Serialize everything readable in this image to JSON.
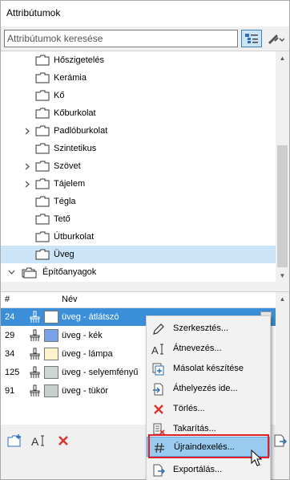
{
  "window": {
    "title": "Attribútumok"
  },
  "search": {
    "placeholder": "Attribútumok keresése"
  },
  "tree": {
    "items": [
      {
        "label": "Hőszigetelés",
        "has_children": false,
        "selected": false
      },
      {
        "label": "Kerámia",
        "has_children": false,
        "selected": false
      },
      {
        "label": "Kő",
        "has_children": false,
        "selected": false
      },
      {
        "label": "Kőburkolat",
        "has_children": false,
        "selected": false
      },
      {
        "label": "Padlóburkolat",
        "has_children": true,
        "selected": false
      },
      {
        "label": "Szintetikus",
        "has_children": false,
        "selected": false
      },
      {
        "label": "Szövet",
        "has_children": true,
        "selected": false
      },
      {
        "label": "Tájelem",
        "has_children": true,
        "selected": false
      },
      {
        "label": "Tégla",
        "has_children": false,
        "selected": false
      },
      {
        "label": "Tető",
        "has_children": false,
        "selected": false
      },
      {
        "label": "Útburkolat",
        "has_children": false,
        "selected": false
      },
      {
        "label": "Üveg",
        "has_children": false,
        "selected": true
      }
    ],
    "group": {
      "label": "Építőanyagok"
    }
  },
  "table": {
    "columns": {
      "num": "#",
      "name": "Név"
    },
    "rows": [
      {
        "num": "24",
        "name": "üveg - átlátszó",
        "swatch": "#ffffff",
        "selected": true
      },
      {
        "num": "29",
        "name": "üveg - kék",
        "swatch": "#7aa0e8",
        "selected": false
      },
      {
        "num": "34",
        "name": "üveg - lámpa",
        "swatch": "#fcf3cc",
        "selected": false
      },
      {
        "num": "125",
        "name": "üveg - selyemfényű",
        "swatch": "#cfd4d4",
        "selected": false
      },
      {
        "num": "91",
        "name": "üveg - tükör",
        "swatch": "#c9cfcf",
        "selected": false
      }
    ]
  },
  "context_menu": {
    "items": [
      {
        "label": "Szerkesztés...",
        "icon": "pencil-icon"
      },
      {
        "label": "Átnevezés...",
        "icon": "rename-icon"
      },
      {
        "label": "Másolat készítése",
        "icon": "duplicate-icon"
      },
      {
        "label": "Áthelyezés ide...",
        "icon": "move-to-icon"
      },
      {
        "label": "Törlés...",
        "icon": "delete-x-icon"
      },
      {
        "label": "Takarítás...",
        "icon": "cleanup-icon"
      },
      {
        "label": "Újraindexelés...",
        "icon": "hash-icon",
        "highlighted": true
      },
      {
        "label": "Exportálás...",
        "icon": "export-icon"
      }
    ]
  },
  "colors": {
    "selection": "#3a8fd8",
    "tree_selection": "#cce4f7",
    "menu_highlight": "#99cbf1",
    "callout_red": "#e0202a",
    "delete_red": "#e0302a",
    "icon_blue": "#2d6fb7"
  }
}
